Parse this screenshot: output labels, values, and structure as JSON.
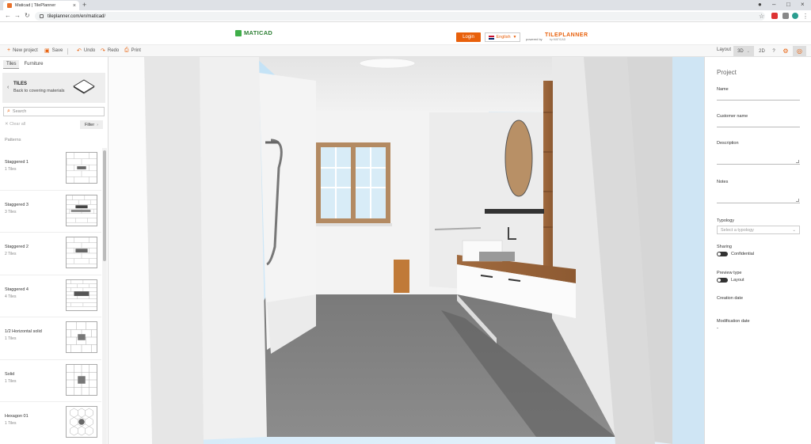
{
  "browser": {
    "tab_title": "Maticad | TilePlanner",
    "url": "tileplanner.com/en/maticad/"
  },
  "header": {
    "logo_text": "MATICAD",
    "login_label": "Login",
    "language": "English",
    "powered_by": "powered by",
    "brand": "TILEPLANNER",
    "brand_sub": "by MATICAD"
  },
  "toolbar": {
    "new_project": "New project",
    "save": "Save",
    "undo": "Undo",
    "redo": "Redo",
    "print": "Print",
    "layout": "Layout",
    "view_3d": "3D",
    "view_2d": "2D",
    "help": "?"
  },
  "left_panel": {
    "tabs": [
      "Tiles",
      "Furniture"
    ],
    "back_title": "TILES",
    "back_subtitle": "Back to covering materials",
    "search_placeholder": "Search",
    "clear_all": "Clear all",
    "filter": "Filter",
    "section_label": "Patterns",
    "patterns": [
      {
        "name": "Staggered 1",
        "count": "1 Tiles"
      },
      {
        "name": "Staggered 3",
        "count": "3 Tiles"
      },
      {
        "name": "Staggered 2",
        "count": "2 Tiles"
      },
      {
        "name": "Staggered 4",
        "count": "4 Tiles"
      },
      {
        "name": "1/2 Horizontal solid",
        "count": "1 Tiles"
      },
      {
        "name": "Solid",
        "count": "1 Tiles"
      },
      {
        "name": "Hexagon 01",
        "count": "1 Tiles"
      }
    ]
  },
  "right_panel": {
    "title": "Project",
    "name_label": "Name",
    "customer_label": "Customer name",
    "description_label": "Description",
    "notes_label": "Notes",
    "typology_label": "Typology",
    "typology_placeholder": "Select a typology",
    "sharing_label": "Sharing",
    "sharing_value": "Confidential",
    "preview_label": "Preview type",
    "preview_value": "Layout",
    "creation_label": "Creation date",
    "modification_label": "Modification date",
    "modification_value": "-"
  },
  "colors": {
    "accent": "#e8600b",
    "brand_green": "#3fae49"
  }
}
